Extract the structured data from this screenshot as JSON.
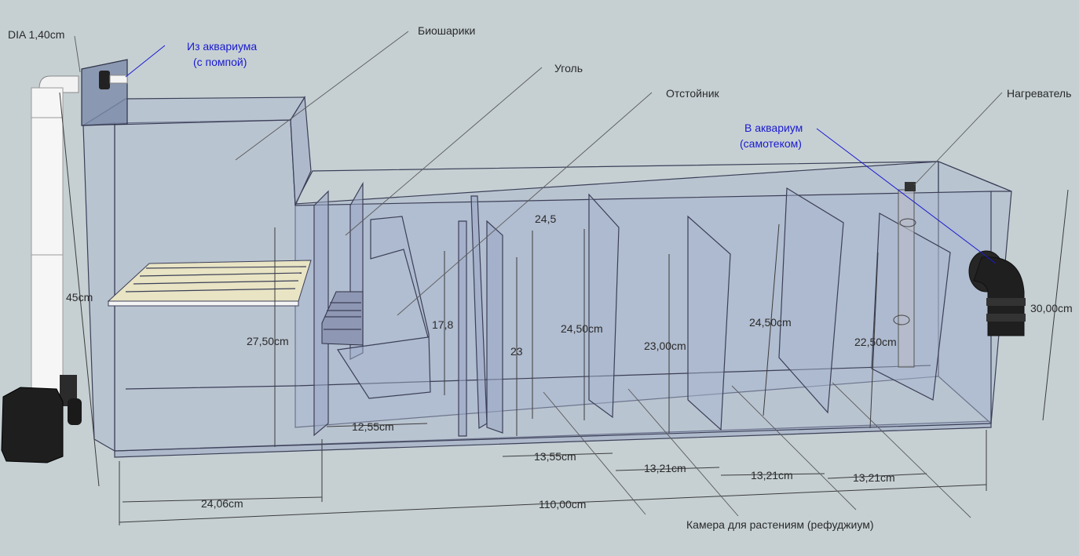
{
  "labels": {
    "dia": "DIA 1,40cm",
    "from_aquarium_1": "Из аквариума",
    "from_aquarium_2": "(с помпой)",
    "bioballs": "Биошарики",
    "charcoal": "Уголь",
    "settler": "Отстойник",
    "heater": "Нагреватель",
    "to_aquarium_1": "В аквариум",
    "to_aquarium_2": "(самотеком)",
    "refugium": "Камера для растениям (рефуджиум)"
  },
  "dimensions": {
    "height_left": "45cm",
    "height_right": "30,00cm",
    "d_24_5": "24,5",
    "d_17_8": "17,8",
    "d_23": "23",
    "d_27_50": "27,50cm",
    "d_24_50_a": "24,50cm",
    "d_23_00": "23,00cm",
    "d_24_50_b": "24,50cm",
    "d_22_50": "22,50cm",
    "d_12_55": "12,55cm",
    "d_13_55": "13,55cm",
    "d_13_21_a": "13,21cm",
    "d_13_21_b": "13,21cm",
    "d_13_21_c": "13,21cm",
    "d_24_06": "24,06cm",
    "d_110": "110,00cm"
  },
  "colors": {
    "background": "#c6d0d3",
    "glass": "#a9b6cf",
    "callout_blue": "#1a1ad0",
    "pump": "#1e1e1e"
  }
}
